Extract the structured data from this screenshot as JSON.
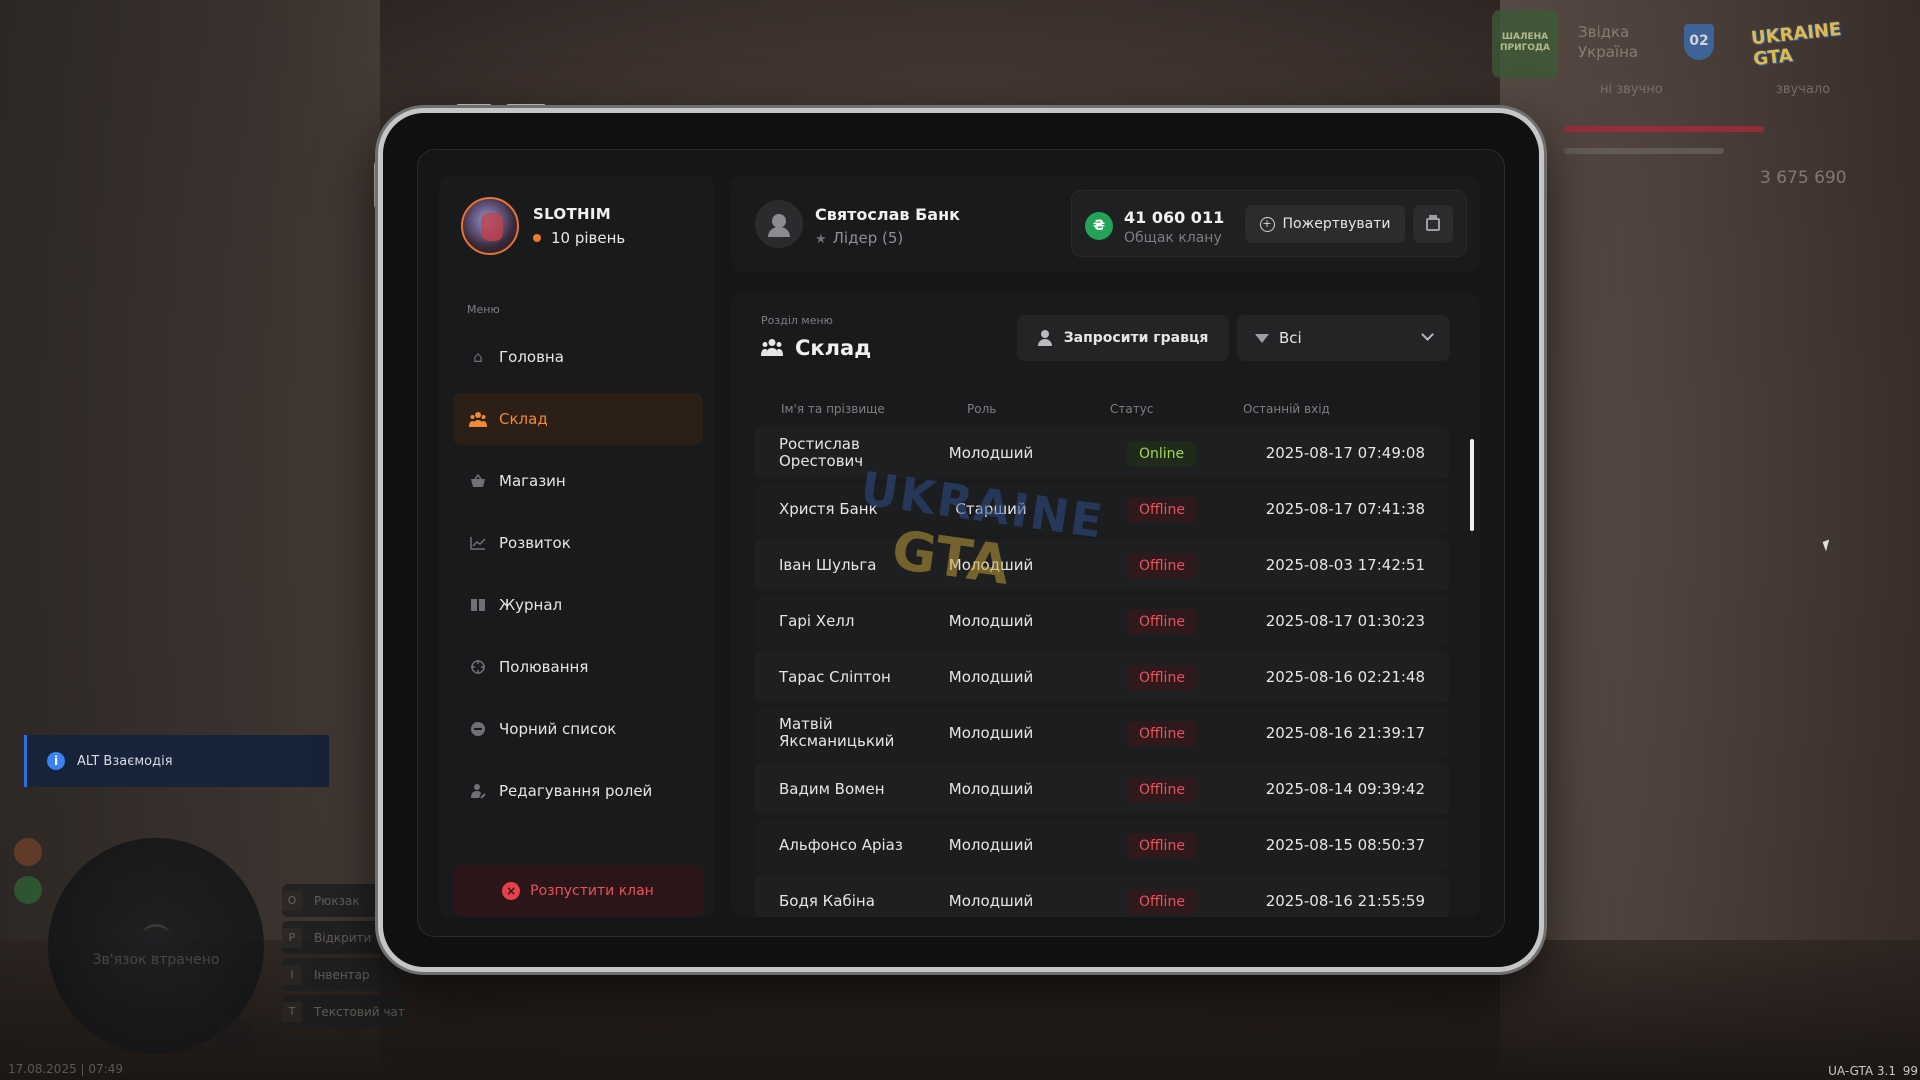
{
  "hud": {
    "logo1_text": "ШАЛЕНА ПРИГОДА",
    "top_text_line1": "Звідка",
    "top_text_line2": "Україна",
    "shield_text": "02",
    "logo2_text": "UKRAINE GTA",
    "dim_left": "ні звучно",
    "dim_right": "звучало",
    "money": "3 675 690",
    "alt_hint": "ALT Взаємодія",
    "radar_text": "Зв'язок втрачено",
    "keys": [
      {
        "key": "O",
        "label": "Рюкзак"
      },
      {
        "key": "P",
        "label": "Відкрити"
      },
      {
        "key": "I",
        "label": "Інвентар"
      },
      {
        "key": "T",
        "label": "Текстовий чат"
      }
    ],
    "timestamp": "17.08.2025 | 07:49",
    "version": "UA-GTA 3.1",
    "fps": "99"
  },
  "profile": {
    "name": "SLOTHIM",
    "level": "10 рівень"
  },
  "menu": {
    "title": "Меню",
    "items": [
      {
        "label": "Головна",
        "icon": "home-icon",
        "glyph": "⌂"
      },
      {
        "label": "Склад",
        "icon": "team-icon",
        "glyph": "👥"
      },
      {
        "label": "Магазин",
        "icon": "basket-icon",
        "glyph": "🛒"
      },
      {
        "label": "Розвиток",
        "icon": "chart-line-icon",
        "glyph": "📈"
      },
      {
        "label": "Журнал",
        "icon": "book-icon",
        "glyph": "📖"
      },
      {
        "label": "Полювання",
        "icon": "crosshair-icon",
        "glyph": "⊕"
      },
      {
        "label": "Чорний список",
        "icon": "block-icon",
        "glyph": "⊖"
      },
      {
        "label": "Редагування ролей",
        "icon": "user-edit-icon",
        "glyph": "👤"
      }
    ],
    "active_index": 1,
    "disband_label": "Розпустити клан"
  },
  "leader": {
    "name": "Святослав Банк",
    "role": "Лідер (5)"
  },
  "treasury": {
    "amount": "41 060 011",
    "label": "Общак клану",
    "currency_symbol": "₴",
    "donate_label": "Пожертвувати"
  },
  "section": {
    "label": "Розділ меню",
    "title": "Склад",
    "invite_label": "Запросити гравця",
    "filter_value": "Всі"
  },
  "table": {
    "headers": {
      "name": "Ім'я та прізвище",
      "role": "Роль",
      "status": "Статус",
      "last_login": "Останній вхід"
    },
    "rows": [
      {
        "name": "Ростислав Орестович",
        "role": "Молодший",
        "status": "Online",
        "date": "2025-08-17 07:49:08"
      },
      {
        "name": "Христя Банк",
        "role": "Старший",
        "status": "Offline",
        "date": "2025-08-17 07:41:38"
      },
      {
        "name": "Іван Шульга",
        "role": "Молодший",
        "status": "Offline",
        "date": "2025-08-03 17:42:51"
      },
      {
        "name": "Гарі Хелл",
        "role": "Молодший",
        "status": "Offline",
        "date": "2025-08-17 01:30:23"
      },
      {
        "name": "Тарас Сліптон",
        "role": "Молодший",
        "status": "Offline",
        "date": "2025-08-16 02:21:48"
      },
      {
        "name": "Матвій Яксманицький",
        "role": "Молодший",
        "status": "Offline",
        "date": "2025-08-16 21:39:17"
      },
      {
        "name": "Вадим Вомен",
        "role": "Молодший",
        "status": "Offline",
        "date": "2025-08-14 09:39:42"
      },
      {
        "name": "Альфонсо Аріаз",
        "role": "Молодший",
        "status": "Offline",
        "date": "2025-08-15 08:50:37"
      },
      {
        "name": "Бодя Кабіна",
        "role": "Молодший",
        "status": "Offline",
        "date": "2025-08-16 21:55:59"
      }
    ]
  },
  "watermark": {
    "line1": "UKRAINE",
    "line2": "GTA"
  },
  "colors": {
    "accent": "#f08a3a",
    "online": "#9fd94f",
    "offline": "#e8505a",
    "coin": "#22a357"
  }
}
